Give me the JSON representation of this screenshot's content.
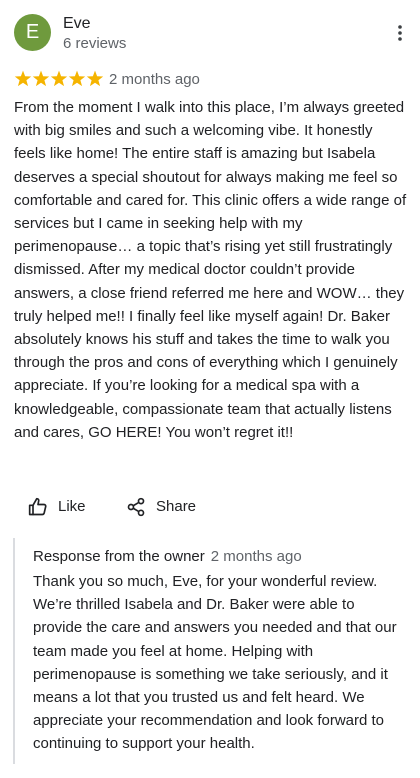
{
  "reviewer": {
    "initial": "E",
    "name": "Eve",
    "review_count": "6 reviews",
    "avatar_color": "#6f9a3d"
  },
  "review": {
    "rating": 5,
    "max_rating": 5,
    "star_color": "#f5b400",
    "date": "2 months ago",
    "text": "From the moment I walk into this place, I’m always greeted with big smiles and such a welcoming vibe. It honestly feels like home! The entire staff is amazing but Isabela deserves a special shoutout for always making me feel so comfortable and cared for. This clinic offers a wide range of services but I came in seeking help with my perimenopause… a topic that’s rising yet still frustratingly dismissed. After my medical doctor couldn’t provide answers, a close friend referred me here and WOW… they truly helped me!! I finally feel like myself again! Dr. Baker absolutely knows his stuff and takes the time to walk you through the pros and cons of everything which I genuinely appreciate. If you’re looking for a medical spa with a knowledgeable, compassionate team that actually listens and cares, GO HERE! You won’t regret it!!"
  },
  "actions": {
    "like_label": "Like",
    "like_icon": "thumbs-up-icon",
    "share_label": "Share",
    "share_icon": "share-icon",
    "more_icon": "more-vertical-icon"
  },
  "owner_response": {
    "title": "Response from the owner",
    "date": "2 months ago",
    "text": "Thank you so much, Eve, for your wonderful review. We’re thrilled Isabela and Dr. Baker were able to provide the care and answers you needed and that our team made you feel at home. Helping with perimenopause is something we take seriously, and it means a lot that you trusted us and felt heard. We appreciate your recommendation and look forward to continuing to support your health."
  }
}
